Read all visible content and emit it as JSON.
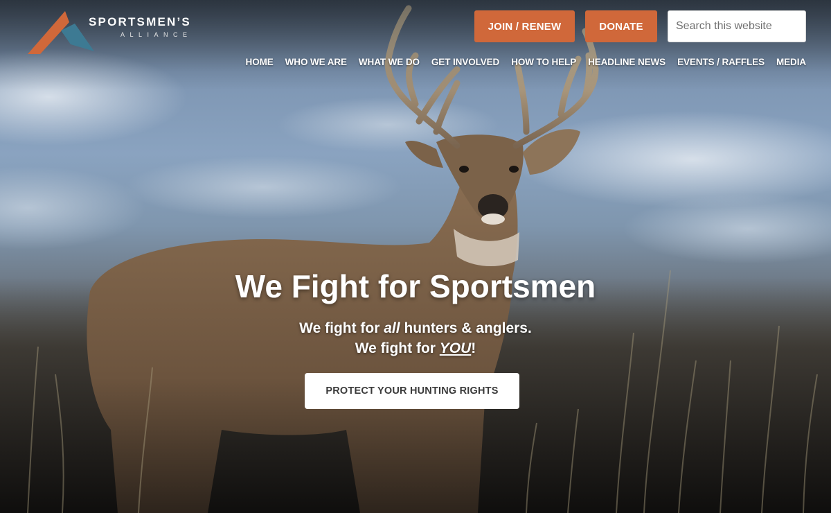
{
  "brand": {
    "name": "SPORTSMEN’S",
    "sub": "ALLIANCE",
    "logo_colors": {
      "orange": "#d0683a",
      "teal": "#3d7a93"
    }
  },
  "header": {
    "join_label": "JOIN / RENEW",
    "donate_label": "DONATE",
    "search_placeholder": "Search this website",
    "search_value": ""
  },
  "nav": {
    "items": [
      {
        "label": "HOME"
      },
      {
        "label": "WHO WE ARE"
      },
      {
        "label": "WHAT WE DO"
      },
      {
        "label": "GET INVOLVED"
      },
      {
        "label": "HOW TO HELP"
      },
      {
        "label": "HEADLINE NEWS"
      },
      {
        "label": "EVENTS / RAFFLES"
      },
      {
        "label": "MEDIA"
      }
    ]
  },
  "hero": {
    "headline": "We Fight for Sportsmen",
    "line1_pre": "We fight for ",
    "line1_em": "all",
    "line1_post": " hunters & anglers.",
    "line2_pre": "We fight for ",
    "line2_em": "YOU",
    "line2_post": "!",
    "cta_label": "PROTECT YOUR HUNTING RIGHTS"
  },
  "colors": {
    "accent": "#d0683a",
    "cta_bg": "#ffffff",
    "cta_text": "#3a3a3a"
  }
}
